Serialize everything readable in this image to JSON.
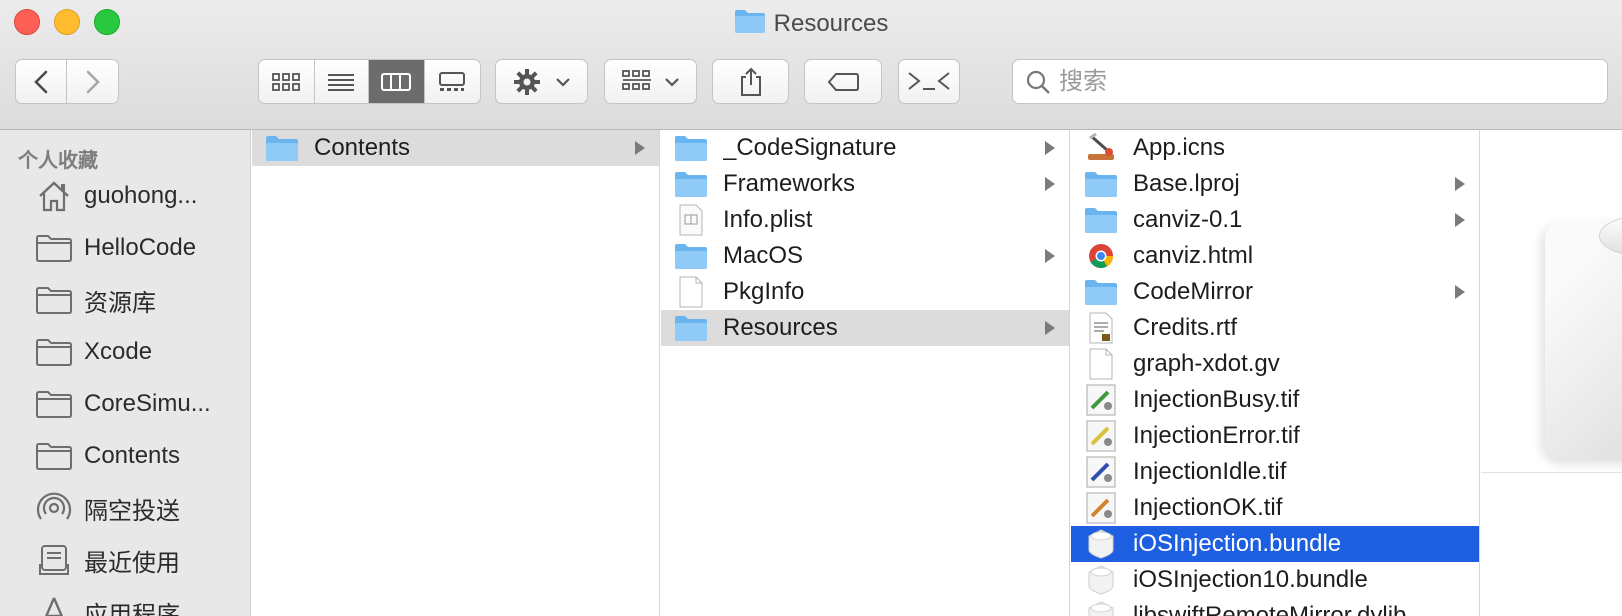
{
  "window": {
    "title": "Resources"
  },
  "search": {
    "placeholder": "搜索"
  },
  "sidebar": {
    "section": "个人收藏",
    "items": [
      {
        "label": "guohong...",
        "icon": "home-icon"
      },
      {
        "label": "HelloCode",
        "icon": "folder-icon"
      },
      {
        "label": "资源库",
        "icon": "folder-icon"
      },
      {
        "label": "Xcode",
        "icon": "folder-icon"
      },
      {
        "label": "CoreSimu...",
        "icon": "folder-icon"
      },
      {
        "label": "Contents",
        "icon": "folder-icon"
      },
      {
        "label": "隔空投送",
        "icon": "airdrop-icon"
      },
      {
        "label": "最近使用",
        "icon": "recents-icon"
      },
      {
        "label": "应用程序",
        "icon": "applications-icon"
      }
    ]
  },
  "columns": {
    "col1": [
      {
        "name": "Contents",
        "type": "folder",
        "has_children": true
      }
    ],
    "col2": [
      {
        "name": "_CodeSignature",
        "type": "folder",
        "has_children": true
      },
      {
        "name": "Frameworks",
        "type": "folder",
        "has_children": true
      },
      {
        "name": "Info.plist",
        "type": "plist",
        "has_children": false
      },
      {
        "name": "MacOS",
        "type": "folder",
        "has_children": true
      },
      {
        "name": "PkgInfo",
        "type": "file",
        "has_children": false
      },
      {
        "name": "Resources",
        "type": "folder",
        "has_children": true
      }
    ],
    "col3": [
      {
        "name": "App.icns",
        "type": "icns",
        "has_children": false
      },
      {
        "name": "Base.lproj",
        "type": "folder",
        "has_children": true
      },
      {
        "name": "canviz-0.1",
        "type": "folder",
        "has_children": true
      },
      {
        "name": "canviz.html",
        "type": "html",
        "has_children": false
      },
      {
        "name": "CodeMirror",
        "type": "folder",
        "has_children": true
      },
      {
        "name": "Credits.rtf",
        "type": "rtf",
        "has_children": false
      },
      {
        "name": "graph-xdot.gv",
        "type": "file",
        "has_children": false
      },
      {
        "name": "InjectionBusy.tif",
        "type": "tif",
        "has_children": false
      },
      {
        "name": "InjectionError.tif",
        "type": "tif",
        "has_children": false
      },
      {
        "name": "InjectionIdle.tif",
        "type": "tif",
        "has_children": false
      },
      {
        "name": "InjectionOK.tif",
        "type": "tif",
        "has_children": false
      },
      {
        "name": "iOSInjection.bundle",
        "type": "bundle",
        "has_children": false
      },
      {
        "name": "iOSInjection10.bundle",
        "type": "bundle",
        "has_children": false
      },
      {
        "name": "libswiftRemoteMirror.dylib",
        "type": "file",
        "has_children": false
      }
    ]
  },
  "colors": {
    "selection": "#1d5fe0",
    "inactive_selection": "#dcdcdc",
    "folder": "#6ab4f0"
  }
}
